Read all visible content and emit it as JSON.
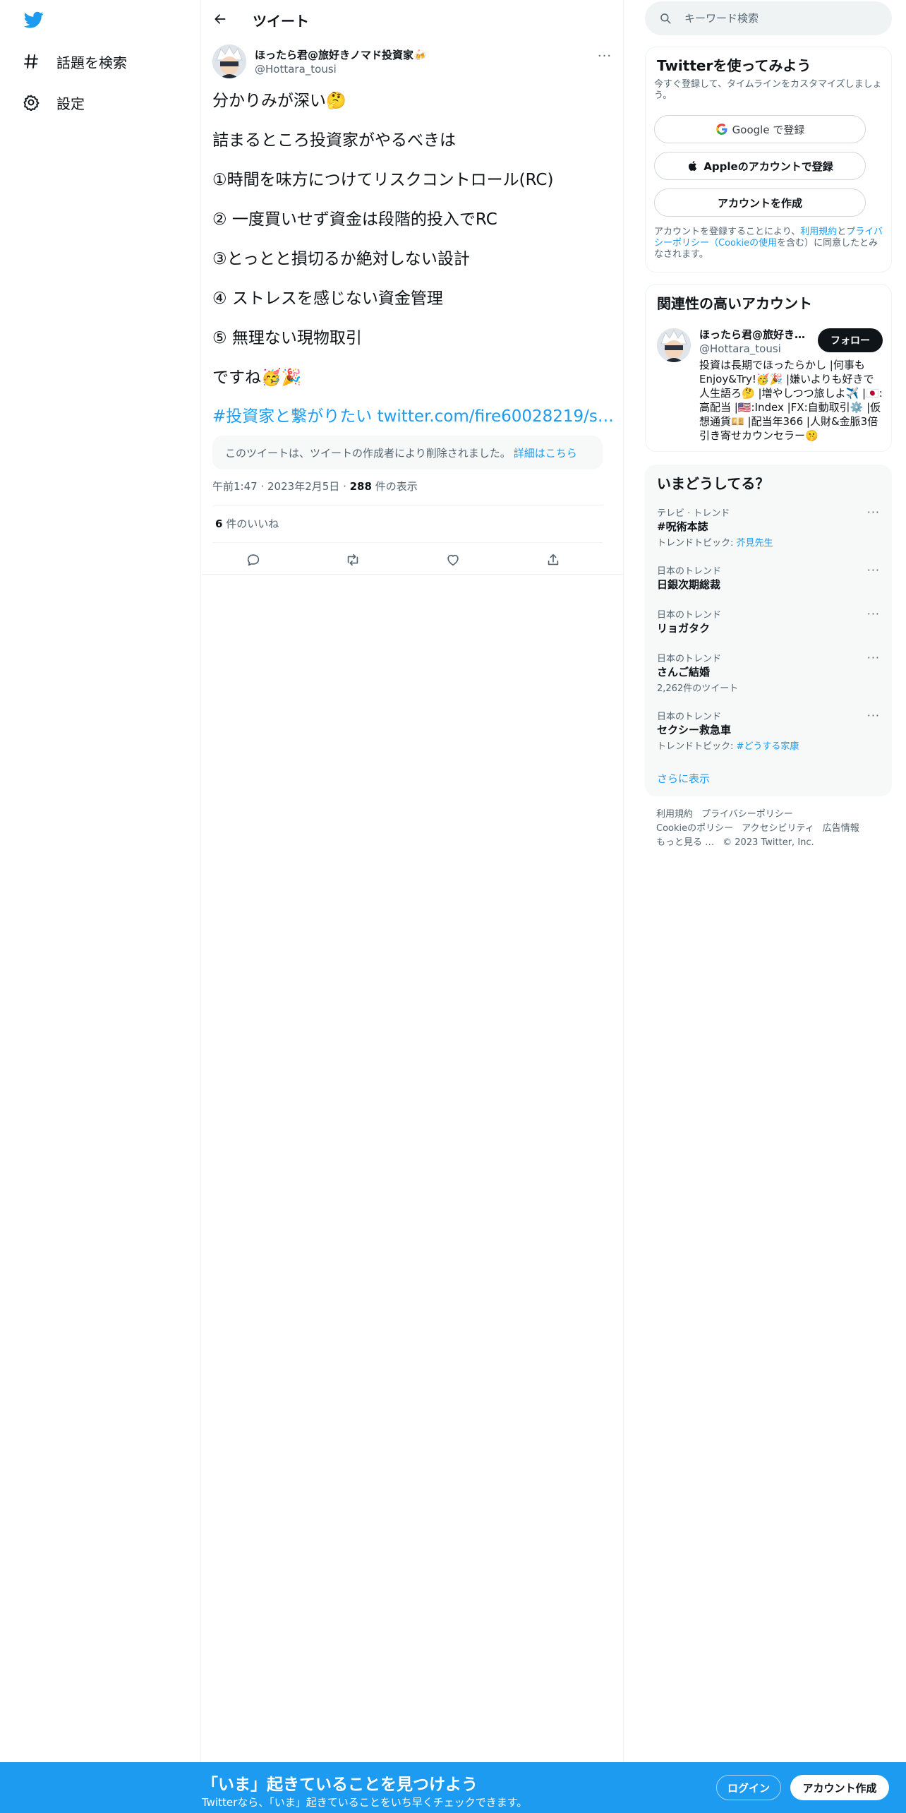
{
  "colors": {
    "accent": "#1d9bf0",
    "text": "#0f1419",
    "muted": "#536471"
  },
  "sidebar": {
    "logo_icon": "twitter-bird-icon",
    "items": [
      {
        "label": "話題を検索",
        "icon": "hashtag-icon"
      },
      {
        "label": "設定",
        "icon": "gear-icon"
      }
    ]
  },
  "main": {
    "header_title": "ツイート",
    "author": {
      "name": "ほったら君@旅好きノマド投資家🍻",
      "handle": "@Hottara_tousi"
    },
    "tweet_lines": [
      "分かりみが深い🤔",
      "詰まるところ投資家がやるべきは",
      "①時間を味方につけてリスクコントロール(RC)",
      "② 一度買いせず資金は段階的投入でRC",
      "③とっとと損切るか絶対しない設計",
      "④ ストレスを感じない資金管理",
      "⑤ 無理ない現物取引",
      "ですね🥳🎉"
    ],
    "tweet_link": "#投資家と繋がりたい twitter.com/fire60028219/s…",
    "deleted_notice": "このツイートは、ツイートの作成者により削除されました。",
    "deleted_more": "詳細はこちら",
    "time": "午前1:47",
    "date": "2023年2月5日",
    "views_count": "288",
    "views_label": "件の表示",
    "likes_count": "6",
    "likes_label": "件のいいね"
  },
  "right": {
    "search_placeholder": "キーワード検索",
    "signup": {
      "title": "Twitterを使ってみよう",
      "subtitle": "今すぐ登録して、タイムラインをカスタマイズしましょう。",
      "google": "Google で登録",
      "apple": "Appleのアカウントで登録",
      "create": "アカウントを作成",
      "legal_1": "アカウントを登録することにより、",
      "legal_terms": "利用規約",
      "legal_and": "と",
      "legal_privacy": "プライバシーポリシー（Cookieの使用",
      "legal_2": "を含む）に同意したとみなされます。"
    },
    "related": {
      "title": "関連性の高いアカウント",
      "name": "ほったら君@旅好き…",
      "handle": "@Hottara_tousi",
      "follow": "フォロー",
      "bio": "投資は長期でほったらかし |何事もEnjoy&Try!🥳🎉 |嫌いよりも好きで人生語ろ🤔 |増やしつつ旅しよ✈️ |🇯🇵:高配当 |🇺🇸:Index |FX:自動取引⚙️ |仮想通貨💴 |配当年366 |人財&金脈3倍引き寄せカウンセラー🤫"
    },
    "trends": {
      "title": "いまどうしてる？",
      "items": [
        {
          "category": "テレビ · トレンド",
          "name": "#呪術本誌",
          "sub_prefix": "トレンドトピック: ",
          "sub_link": "芥見先生"
        },
        {
          "category": "日本のトレンド",
          "name": "日銀次期総裁",
          "sub_prefix": "",
          "sub_link": ""
        },
        {
          "category": "日本のトレンド",
          "name": "リョガタク",
          "sub_prefix": "",
          "sub_link": ""
        },
        {
          "category": "日本のトレンド",
          "name": "さんご結婚",
          "sub_prefix": "2,262件のツイート",
          "sub_link": ""
        },
        {
          "category": "日本のトレンド",
          "name": "セクシー救急車",
          "sub_prefix": "トレンドトピック: ",
          "sub_link": "#どうする家康"
        }
      ],
      "show_more": "さらに表示"
    },
    "footer": {
      "terms": "利用規約",
      "privacy": "プライバシーポリシー",
      "cookie": "Cookieのポリシー",
      "accessibility": "アクセシビリティ",
      "ads": "広告情報",
      "more": "もっと見る …",
      "copyright": "© 2023 Twitter, Inc."
    }
  },
  "bottom_bar": {
    "title": "「いま」起きていることを見つけよう",
    "subtitle": "Twitterなら、「いま」起きていることをいち早くチェックできます。",
    "login": "ログイン",
    "signup": "アカウント作成"
  }
}
